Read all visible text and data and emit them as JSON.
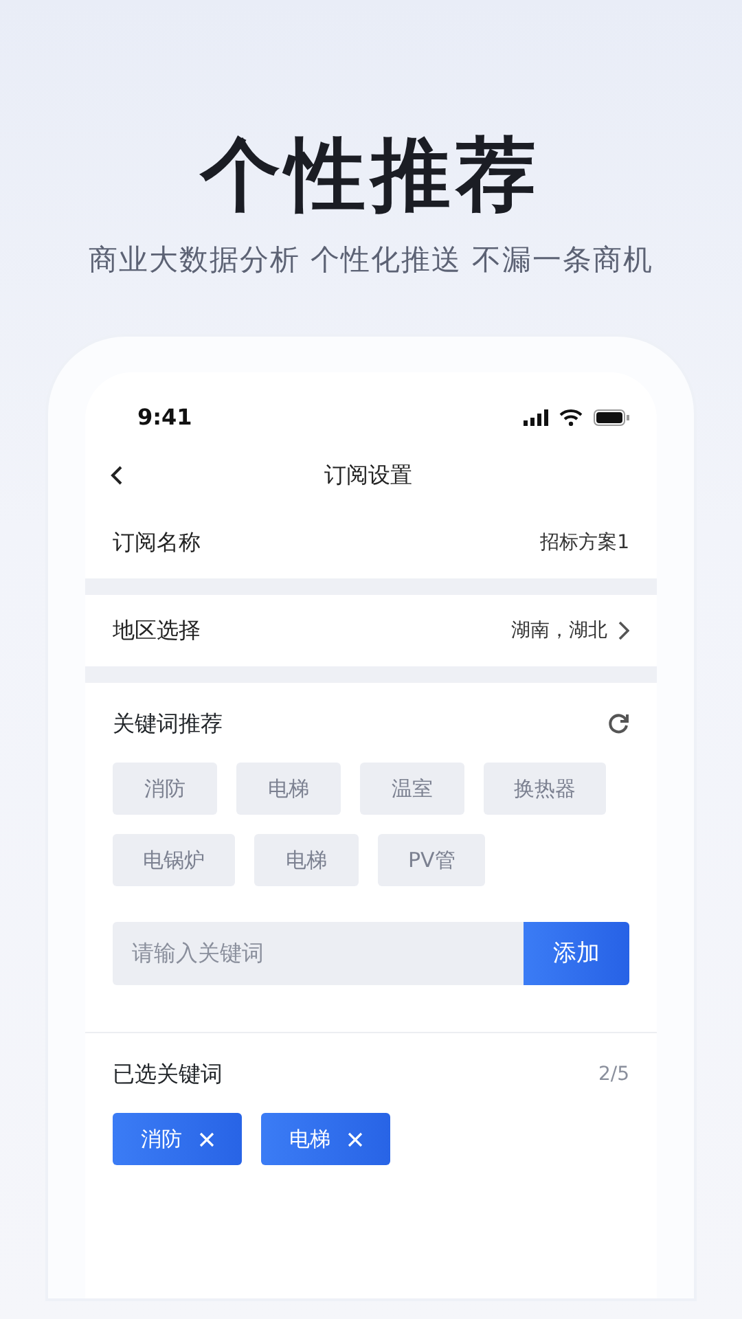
{
  "headline": "个性推荐",
  "subheadline": "商业大数据分析 个性化推送 不漏一条商机",
  "status_bar": {
    "time": "9:41"
  },
  "nav": {
    "title": "订阅设置"
  },
  "rows": [
    {
      "label": "订阅名称",
      "value": "招标方案1",
      "chevron": false
    },
    {
      "label": "地区选择",
      "value": "湖南，湖北",
      "chevron": true
    }
  ],
  "keywords": {
    "title": "关键词推荐",
    "tags": [
      "消防",
      "电梯",
      "温室",
      "换热器",
      "电锅炉",
      "电梯",
      "PV管"
    ],
    "input": {
      "placeholder": "请输入关键词"
    },
    "add_button": "添加"
  },
  "selected": {
    "title": "已选关键词",
    "count": "2/5",
    "chips": [
      {
        "label": "消防"
      },
      {
        "label": "电梯"
      }
    ]
  }
}
